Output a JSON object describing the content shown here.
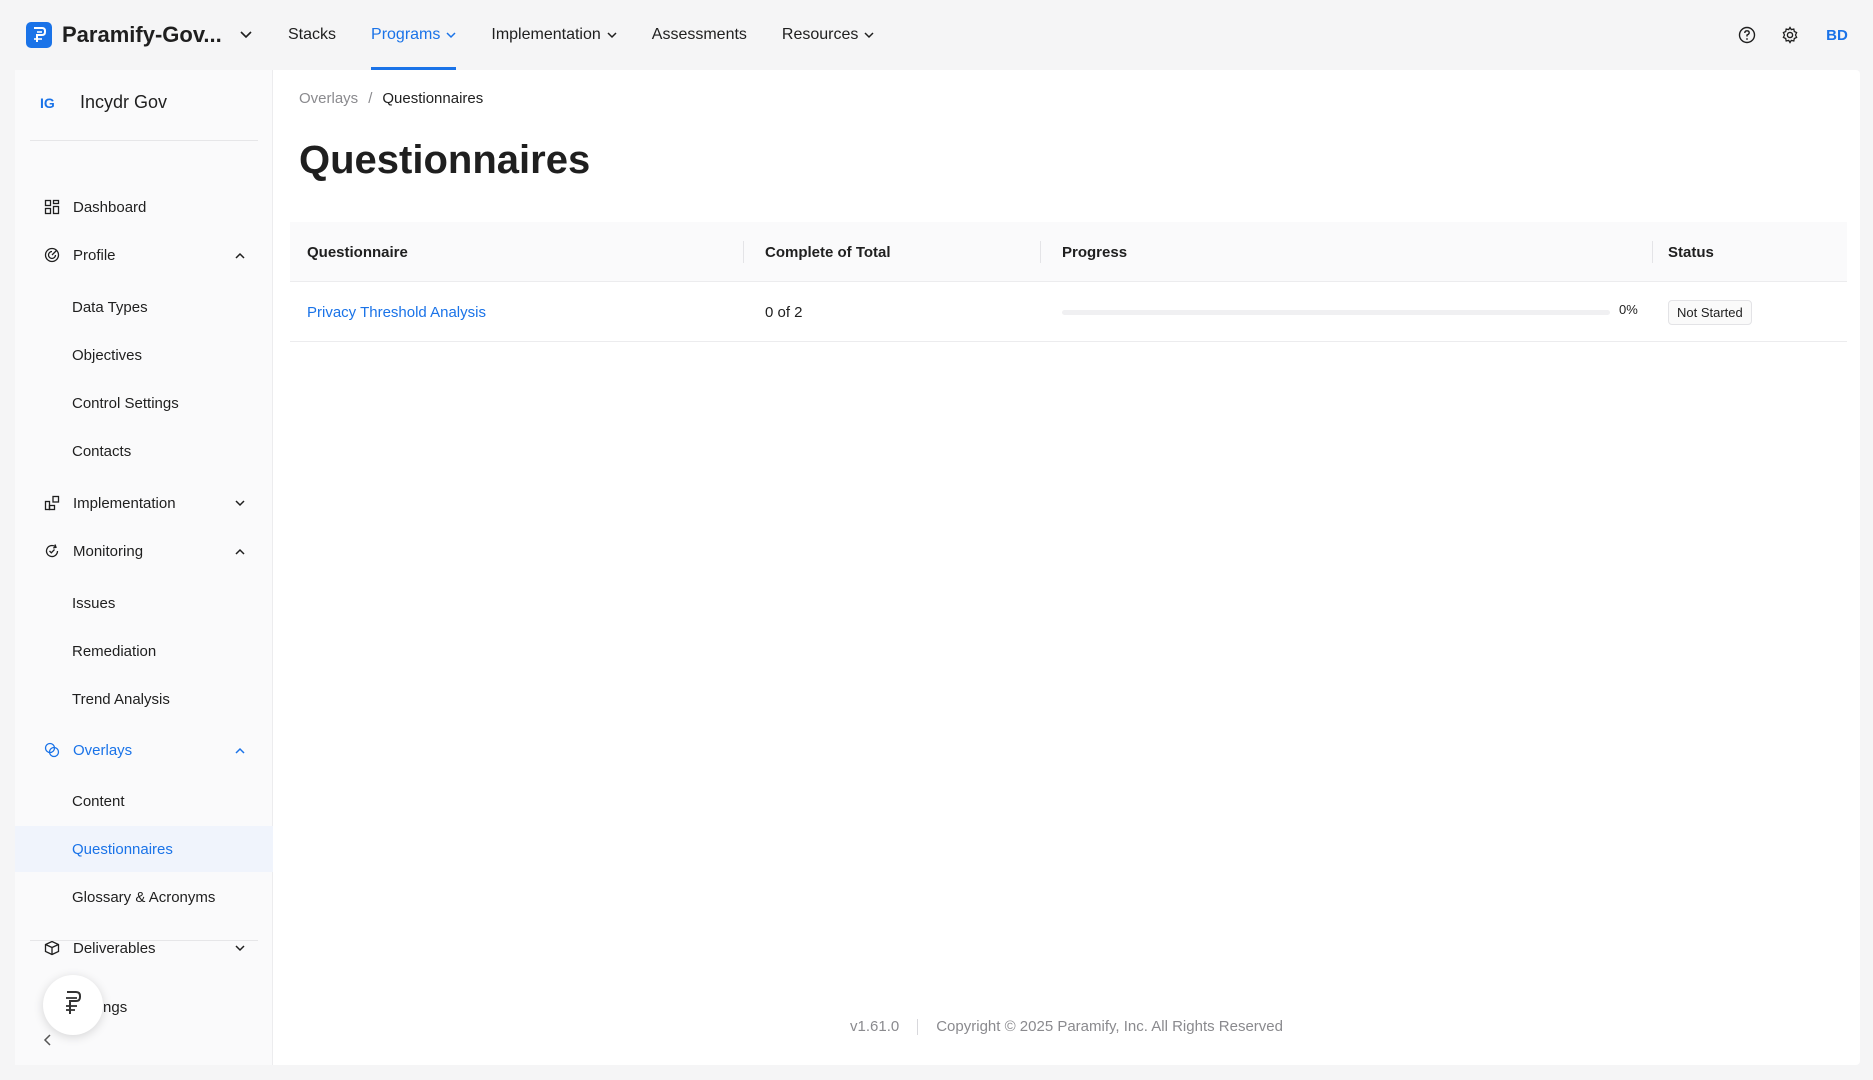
{
  "brand": {
    "name": "Paramify-Gov..."
  },
  "nav": {
    "items": [
      {
        "label": "Stacks",
        "dropdown": false
      },
      {
        "label": "Programs",
        "dropdown": true,
        "active": true
      },
      {
        "label": "Implementation",
        "dropdown": true
      },
      {
        "label": "Assessments",
        "dropdown": false
      },
      {
        "label": "Resources",
        "dropdown": true
      }
    ]
  },
  "user": {
    "initials": "BD"
  },
  "org": {
    "badge": "IG",
    "name": "Incydr Gov"
  },
  "sidebar": {
    "dashboard": "Dashboard",
    "profile": "Profile",
    "data_types": "Data Types",
    "objectives": "Objectives",
    "control_settings": "Control Settings",
    "contacts": "Contacts",
    "implementation": "Implementation",
    "monitoring": "Monitoring",
    "issues": "Issues",
    "remediation": "Remediation",
    "trend_analysis": "Trend Analysis",
    "overlays": "Overlays",
    "content": "Content",
    "questionnaires": "Questionnaires",
    "glossary": "Glossary & Acronyms",
    "deliverables": "Deliverables",
    "settings": "Settings"
  },
  "breadcrumb": {
    "parent": "Overlays",
    "separator": "/",
    "current": "Questionnaires"
  },
  "page": {
    "title": "Questionnaires"
  },
  "table": {
    "headers": {
      "questionnaire": "Questionnaire",
      "complete": "Complete of Total",
      "progress": "Progress",
      "status": "Status"
    },
    "rows": [
      {
        "name": "Privacy Threshold Analysis",
        "complete": "0 of 2",
        "progress_value": 0,
        "progress_label": "0%",
        "status": "Not Started"
      }
    ]
  },
  "footer": {
    "version": "v1.61.0",
    "copyright": "Copyright © 2025 Paramify, Inc. All Rights Reserved"
  },
  "colors": {
    "accent": "#1a73e8",
    "text": "#1f1f1f",
    "muted": "#8a8a8e"
  }
}
